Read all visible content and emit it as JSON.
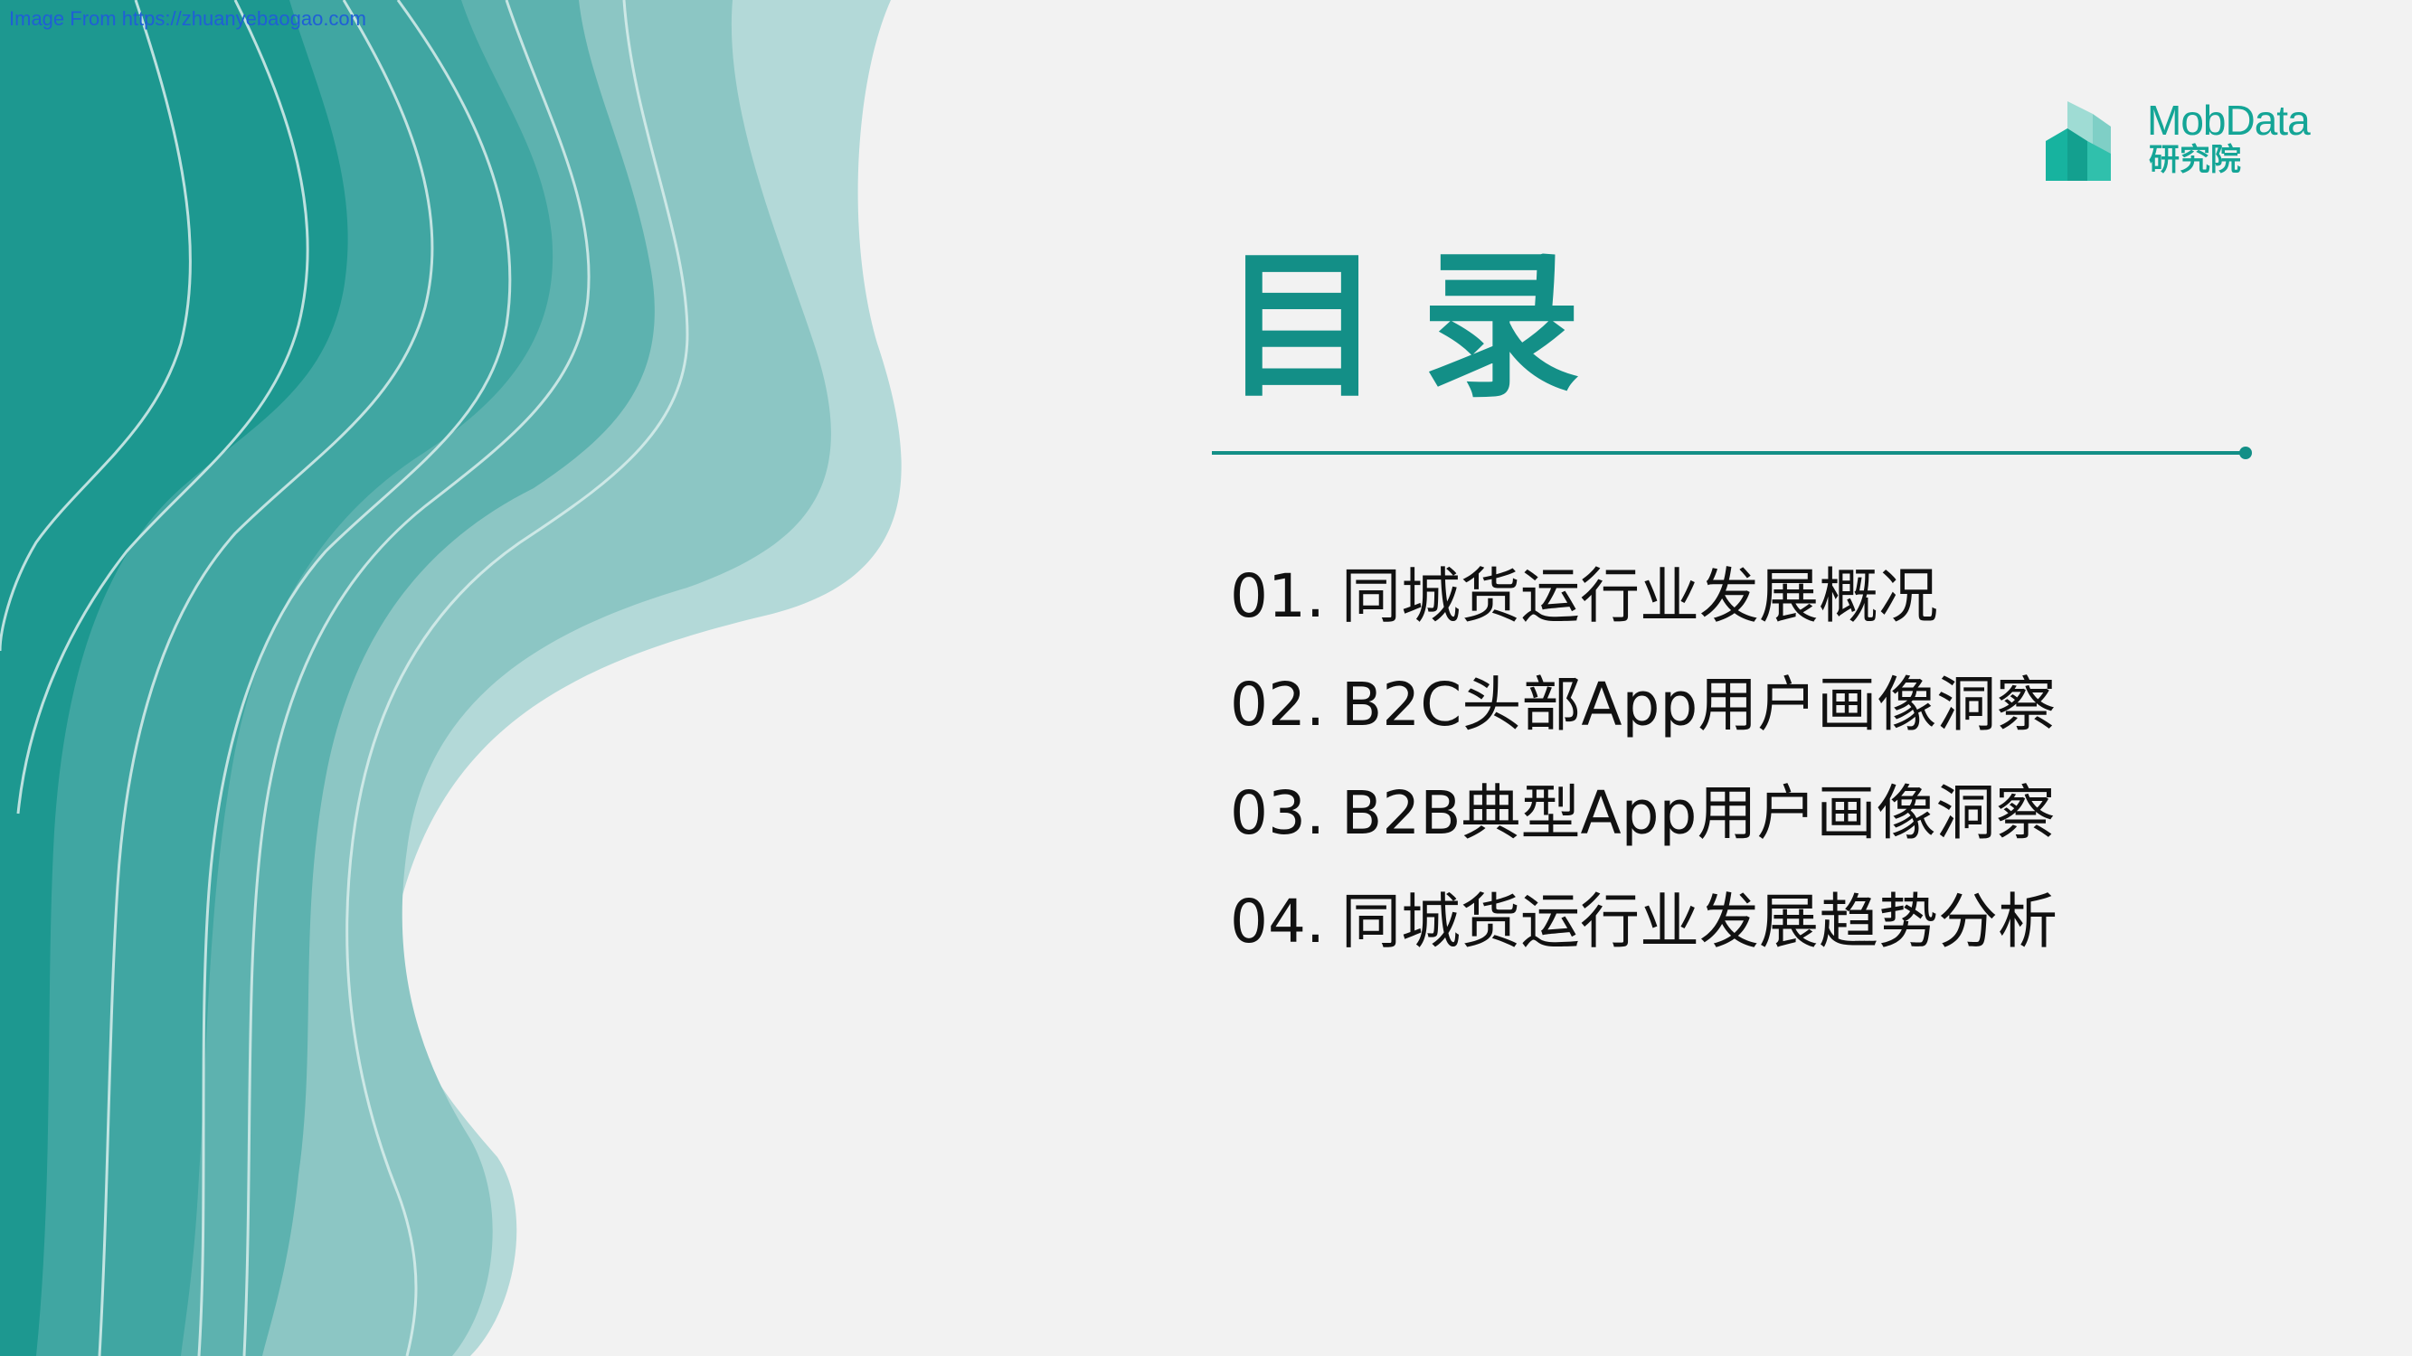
{
  "watermark": "Image From https://zhuanyebaogao.com",
  "logo": {
    "name": "MobData",
    "subtitle": "研究院",
    "icon": "building-bars-logo-icon"
  },
  "title": "目录",
  "toc": [
    {
      "number": "01.",
      "label": "同城货运行业发展概况"
    },
    {
      "number": "02.",
      "label": "B2C头部App用户画像洞察"
    },
    {
      "number": "03.",
      "label": "B2B典型App用户画像洞察"
    },
    {
      "number": "04.",
      "label": "同城货运行业发展趋势分析"
    }
  ],
  "colors": {
    "background": "#f2f2f2",
    "accent": "#138f87",
    "logo": "#14a596",
    "text": "#111111",
    "watermark": "#1f5fd6",
    "wave_light": "#b2d8d8",
    "wave_mid": "#5fb3b0",
    "wave_dark": "#1a958d"
  }
}
